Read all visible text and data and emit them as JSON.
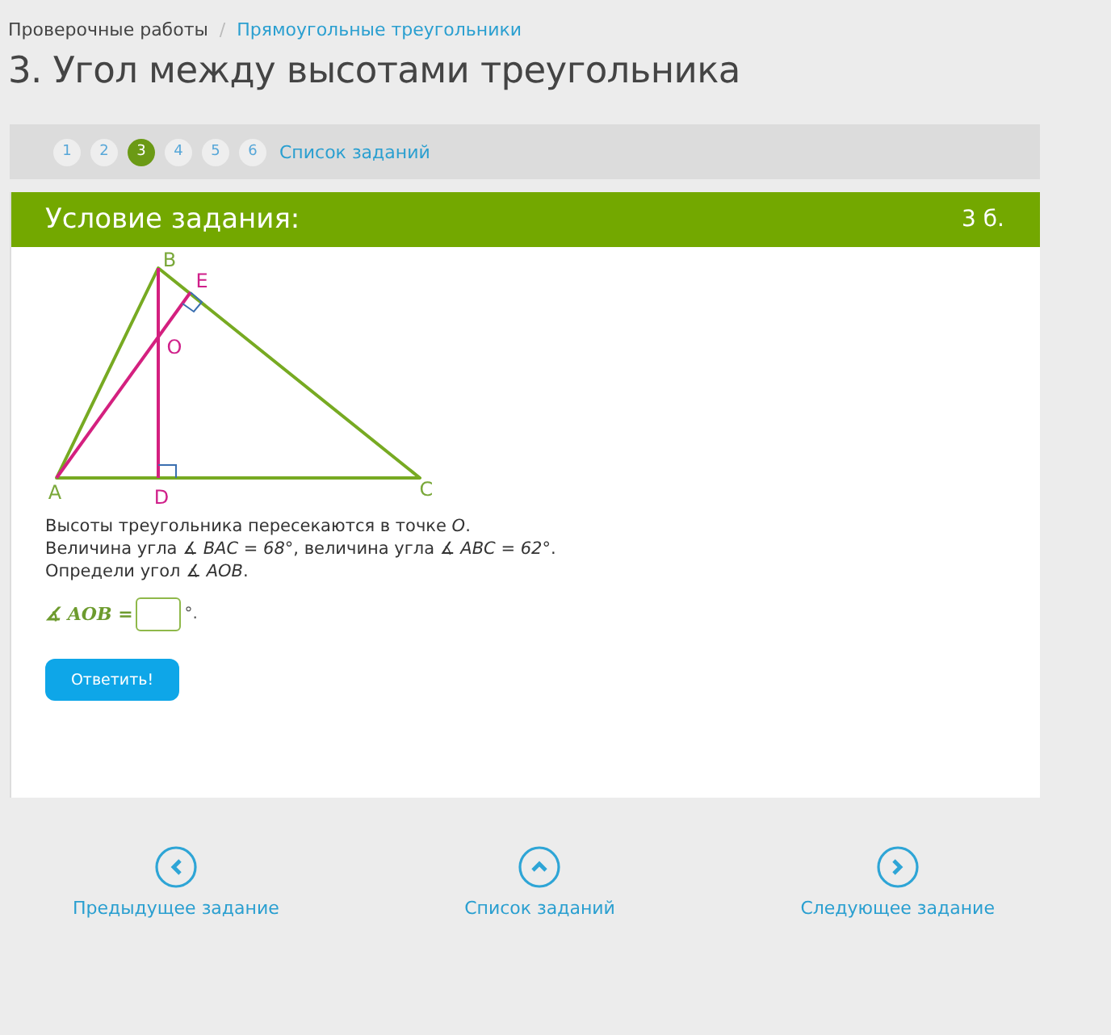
{
  "breadcrumbs": [
    {
      "label": "Проверочные работы",
      "link": false
    },
    {
      "label": "Прямоугольные треугольники",
      "link": true
    }
  ],
  "separator": "/",
  "title": "3. Угол между высотами треугольника",
  "pager": {
    "pages": [
      {
        "label": "1",
        "selected": false
      },
      {
        "label": "2",
        "selected": false
      },
      {
        "label": "3",
        "selected": true
      },
      {
        "label": "4",
        "selected": false
      },
      {
        "label": "5",
        "selected": false
      },
      {
        "label": "6",
        "selected": false
      }
    ],
    "list_link": "Список заданий"
  },
  "task": {
    "heading": "Условие задания:",
    "points": "3 б.",
    "figure": {
      "labels": [
        "A",
        "B",
        "C",
        "D",
        "E",
        "O"
      ]
    },
    "lines": [
      "Высоты треугольника пересекаются в точке *O*.",
      "Величина угла *∡ BAC = 68°*, величина угла *∡ ABC = 62°*.",
      "Определи угол *∡ AOB*."
    ],
    "answer": {
      "label": "∡ AOB =",
      "suffix": "°."
    },
    "submit": "Ответить!"
  },
  "nav": [
    {
      "kind": "prev",
      "label": "Предыдущее задание"
    },
    {
      "kind": "list",
      "label": "Список заданий"
    },
    {
      "kind": "next",
      "label": "Следующее задание"
    }
  ]
}
